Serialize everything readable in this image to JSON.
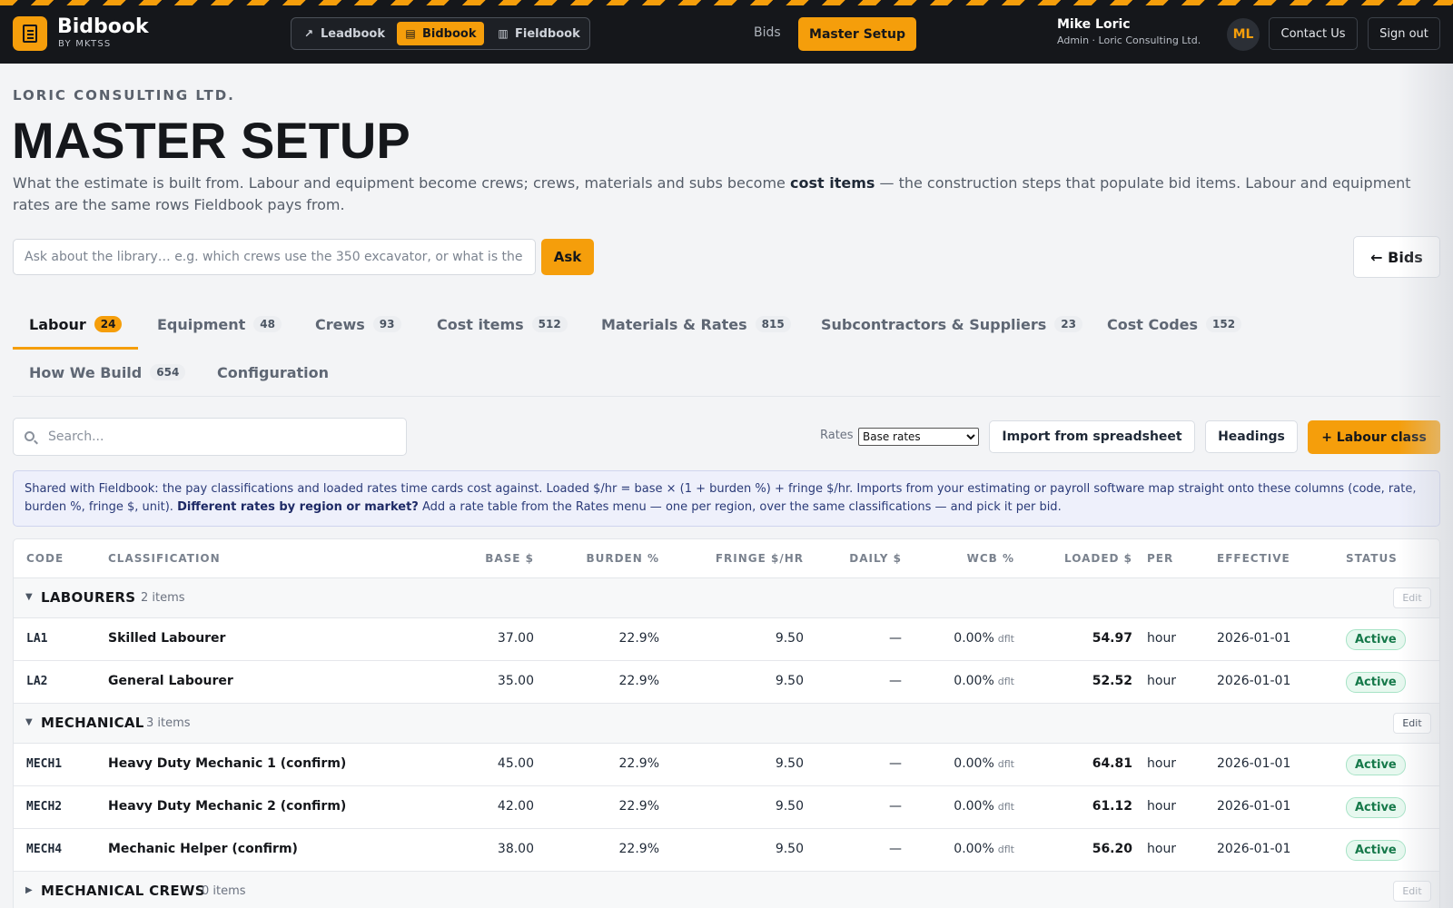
{
  "brand": {
    "title": "Bidbook",
    "subtitle": "BY MKTSS"
  },
  "app_switcher": [
    {
      "label": "Leadbook",
      "icon": "trend-up-icon",
      "active": false
    },
    {
      "label": "Bidbook",
      "icon": "document-icon",
      "active": true
    },
    {
      "label": "Fieldbook",
      "icon": "notes-icon",
      "active": false
    }
  ],
  "nav": {
    "bids": "Bids",
    "master_setup": "Master Setup"
  },
  "user": {
    "name": "Mike Loric",
    "role": "Admin · Loric Consulting Ltd.",
    "initials": "ML"
  },
  "top_actions": {
    "contact": "Contact Us",
    "signout": "Sign out"
  },
  "header": {
    "org": "LORIC CONSULTING LTD.",
    "title": "MASTER SETUP",
    "desc_before": "What the estimate is built from. Labour and equipment become crews; crews, materials and subs become ",
    "desc_bold": "cost items",
    "desc_after": " — the construction steps that populate bid items. Labour and equipment rates are the same rows Fieldbook pays from."
  },
  "ask": {
    "placeholder": "Ask about the library… e.g. which crews use the 350 excavator, or what is the loaded rate for a skilled labourer",
    "button": "Ask"
  },
  "back_button": "← Bids",
  "tabs": [
    {
      "label": "Labour",
      "count": "24",
      "active": true
    },
    {
      "label": "Equipment",
      "count": "48"
    },
    {
      "label": "Crews",
      "count": "93"
    },
    {
      "label": "Cost items",
      "count": "512"
    },
    {
      "label": "Materials & Rates",
      "count": "815"
    },
    {
      "label": "Subcontractors & Suppliers",
      "count": "23"
    },
    {
      "label": "Cost Codes",
      "count": "152"
    },
    {
      "label": "How We Build",
      "count": "654"
    },
    {
      "label": "Configuration",
      "count": ""
    }
  ],
  "toolbar": {
    "search_placeholder": "Search...",
    "rates_label": "Rates",
    "rates_selected": "Base rates",
    "import": "Import from spreadsheet",
    "headings": "Headings",
    "add": "+ Labour class"
  },
  "info": {
    "text": "Shared with Fieldbook: the pay classifications and loaded rates time cards cost against. Loaded $/hr = base × (1 + burden %) + fringe $/hr. Imports from your estimating or payroll software map straight onto these columns (code, rate, burden %, fringe $, unit). ",
    "bold": "Different rates by region or market?",
    "after": " Add a rate table from the Rates menu — one per region, over the same classifications — and pick it per bid."
  },
  "table": {
    "columns": {
      "code": "CODE",
      "classification": "CLASSIFICATION",
      "base": "BASE $",
      "burden": "BURDEN %",
      "fringe": "FRINGE $/HR",
      "daily": "DAILY $",
      "wcb": "WCB %",
      "loaded": "LOADED $",
      "per": "PER",
      "effective": "EFFECTIVE",
      "status": "STATUS"
    },
    "edit_label": "Edit",
    "groups": [
      {
        "name": "LABOURERS",
        "count": "2 items",
        "expanded": true,
        "rows": [
          {
            "code": "LA1",
            "classification": "Skilled Labourer",
            "base": "37.00",
            "burden": "22.9%",
            "fringe": "9.50",
            "daily": "—",
            "wcb": "0.00%",
            "wcb_note": "dflt",
            "loaded": "54.97",
            "per": "hour",
            "effective": "2026-01-01",
            "status": "Active"
          },
          {
            "code": "LA2",
            "classification": "General Labourer",
            "base": "35.00",
            "burden": "22.9%",
            "fringe": "9.50",
            "daily": "—",
            "wcb": "0.00%",
            "wcb_note": "dflt",
            "loaded": "52.52",
            "per": "hour",
            "effective": "2026-01-01",
            "status": "Active"
          }
        ]
      },
      {
        "name": "MECHANICAL",
        "count": "3 items",
        "expanded": true,
        "rows": [
          {
            "code": "MECH1",
            "classification": "Heavy Duty Mechanic 1 (confirm)",
            "base": "45.00",
            "burden": "22.9%",
            "fringe": "9.50",
            "daily": "—",
            "wcb": "0.00%",
            "wcb_note": "dflt",
            "loaded": "64.81",
            "per": "hour",
            "effective": "2026-01-01",
            "status": "Active"
          },
          {
            "code": "MECH2",
            "classification": "Heavy Duty Mechanic 2 (confirm)",
            "base": "42.00",
            "burden": "22.9%",
            "fringe": "9.50",
            "daily": "—",
            "wcb": "0.00%",
            "wcb_note": "dflt",
            "loaded": "61.12",
            "per": "hour",
            "effective": "2026-01-01",
            "status": "Active"
          },
          {
            "code": "MECH4",
            "classification": "Mechanic Helper (confirm)",
            "base": "38.00",
            "burden": "22.9%",
            "fringe": "9.50",
            "daily": "—",
            "wcb": "0.00%",
            "wcb_note": "dflt",
            "loaded": "56.20",
            "per": "hour",
            "effective": "2026-01-01",
            "status": "Active"
          }
        ]
      },
      {
        "name": "MECHANICAL CREWS",
        "count": "0 items",
        "expanded": false,
        "rows": []
      }
    ]
  },
  "colors": {
    "accent": "#f59e0b",
    "topbar": "#15171b",
    "active_status": "#16794a",
    "info_bg": "#eef0fb"
  }
}
